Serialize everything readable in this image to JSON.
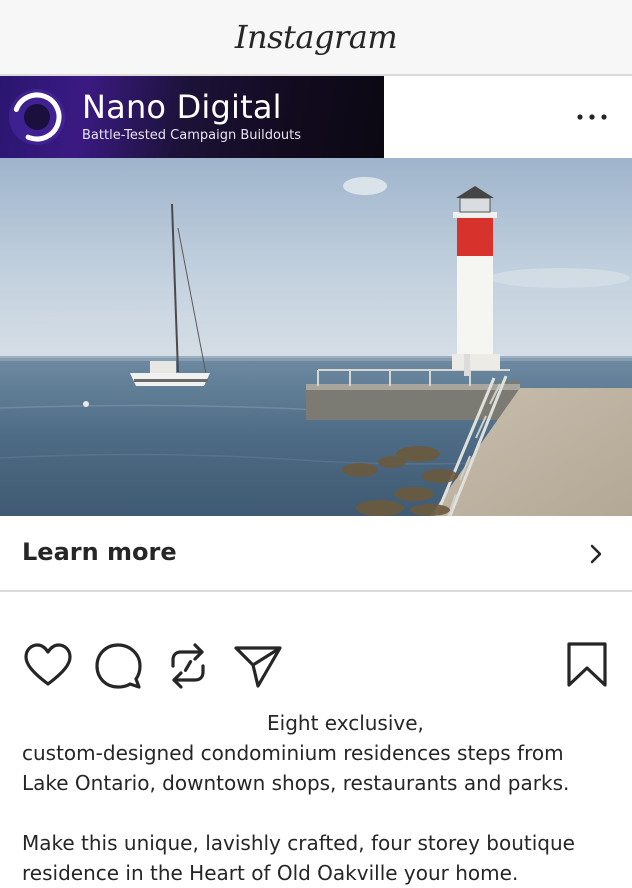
{
  "app": {
    "title": "Instagram"
  },
  "post": {
    "account_name": "Nano Digital",
    "account_tagline": "Battle-Tested Campaign Buildouts",
    "cta_label": "Learn more",
    "caption_lines": [
      "Eight exclusive,",
      "custom-designed condominium residences steps from",
      "Lake Ontario, downtown shops, restaurants and parks.",
      "",
      "Make this unique, lavishly crafted, four storey boutique",
      "residence in the Heart of Old Oakville your home."
    ]
  },
  "icons": {
    "more": "more-horizontal-icon",
    "cta": "chevron-right-icon",
    "like": "heart-icon",
    "comment": "comment-bubble-icon",
    "repost": "repost-arrows-icon",
    "share": "paper-plane-icon",
    "save": "bookmark-icon"
  },
  "colors": {
    "text": "#262626",
    "divider": "#dbdbdb",
    "topbar_bg": "#f7f7f7",
    "brand_purple": "#3a1a82",
    "lighthouse_red": "#d7322c"
  }
}
